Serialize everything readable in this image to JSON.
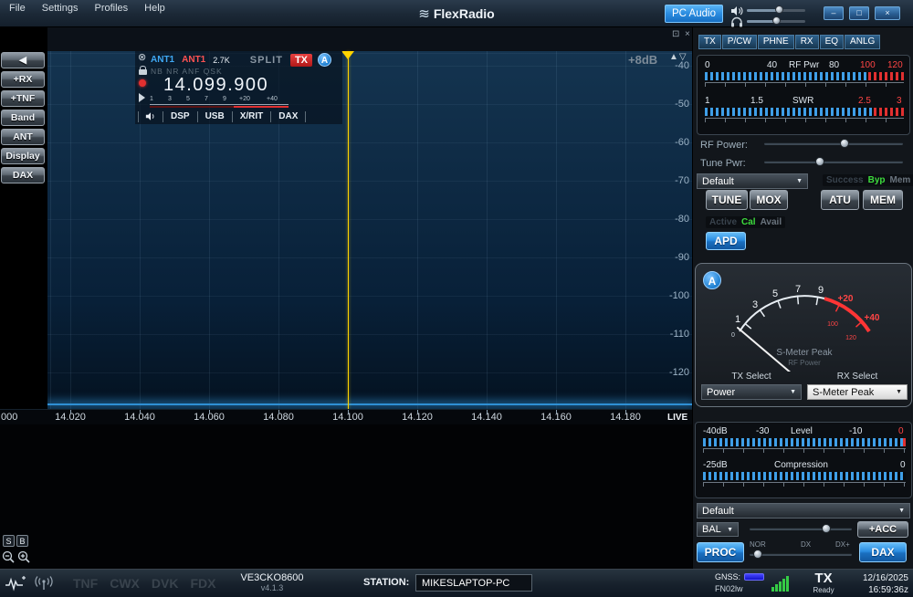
{
  "icons": {
    "wave": "≋",
    "minimize": "–",
    "maximize": "□",
    "close": "×",
    "popout": "⊡",
    "tri_up": "▲",
    "tri_down": "▽",
    "back": "◀",
    "dd_arrow": "▼",
    "antenna_cross": "⊗"
  },
  "titlebar": {
    "menus": [
      "File",
      "Settings",
      "Profiles",
      "Help"
    ],
    "brand": "FlexRadio",
    "pc_audio_label": "PC Audio"
  },
  "sidebar": {
    "items": [
      "+RX",
      "+TNF",
      "Band",
      "ANT",
      "Display",
      "DAX"
    ]
  },
  "panadapter": {
    "gain_label": "+8dB",
    "db_ticks": [
      "-40",
      "-50",
      "-60",
      "-70",
      "-80",
      "-90",
      "-100",
      "-110",
      "-120"
    ],
    "freq_edge": "000",
    "freq_ticks": [
      "14.020",
      "14.040",
      "14.060",
      "14.080",
      "14.100",
      "14.120",
      "14.140",
      "14.160",
      "14.180"
    ],
    "live_label": "LIVE",
    "flag": {
      "rx_ant": "ANT1",
      "tx_ant": "ANT1",
      "filter": "2.7K",
      "split": "SPLIT",
      "tx_badge": "TX",
      "slice": "A",
      "dsp_flags": "NB NR ANF QSK",
      "frequency": "14.099.900",
      "smeter_ticks": [
        "1",
        "3",
        "5",
        "7",
        "9",
        "+20",
        "+40"
      ],
      "mode_buttons": [
        "DSP",
        "USB",
        "X/RIT",
        "DAX"
      ]
    },
    "waterfall_s": "S",
    "waterfall_b": "B"
  },
  "right_panel": {
    "tabs": [
      "TX",
      "P/CW",
      "PHNE",
      "RX",
      "EQ",
      "ANLG"
    ],
    "rf_meter_labels": [
      "0",
      "40",
      "RF Pwr",
      "80",
      "100",
      "120"
    ],
    "swr_meter_labels": [
      "1",
      "1.5",
      "SWR",
      "2.5",
      "3"
    ],
    "rf_power_label": "RF Power:",
    "tune_pwr_label": "Tune Pwr:",
    "profile_value": "Default",
    "atu_status": [
      "Success",
      "Byp",
      "Mem"
    ],
    "tune_label": "TUNE",
    "mox_label": "MOX",
    "atu_label": "ATU",
    "mem_label": "MEM",
    "apd_status": [
      "Active",
      "Cal",
      "Avail"
    ],
    "apd_label": "APD",
    "gauge": {
      "slice": "A",
      "ticks_white": [
        "1",
        "3",
        "5",
        "7",
        "9"
      ],
      "ticks_red": [
        "+20",
        "+40"
      ],
      "power_ticks": [
        "100",
        "120"
      ],
      "zero": "0",
      "title": "S-Meter Peak",
      "subtitle": "RF Power"
    },
    "tx_select_label": "TX Select",
    "rx_select_label": "RX Select",
    "tx_select_value": "Power",
    "rx_select_value": "S-Meter Peak",
    "level_labels": [
      "-40dB",
      "-30",
      "Level",
      "-10",
      "0"
    ],
    "comp_labels": [
      "-25dB",
      "Compression",
      "0"
    ],
    "mic_profile_value": "Default",
    "bal_label": "BAL",
    "acc_label": "+ACC",
    "proc_label": "PROC",
    "proc_modes": [
      "NOR",
      "DX",
      "DX+"
    ],
    "dax_label": "DAX"
  },
  "statusbar": {
    "toggles": [
      "TNF",
      "CWX",
      "DVK",
      "FDX"
    ],
    "radio_name": "VE3CKO8600",
    "version": "v4.1.3",
    "station_label": "STATION:",
    "station_value": "MIKESLAPTOP-PC",
    "gnss_label": "GNSS:",
    "grid_square": "FN02lw",
    "tx_label": "TX",
    "tx_status": "Ready",
    "date": "12/16/2025",
    "time": "16:59:36z"
  }
}
